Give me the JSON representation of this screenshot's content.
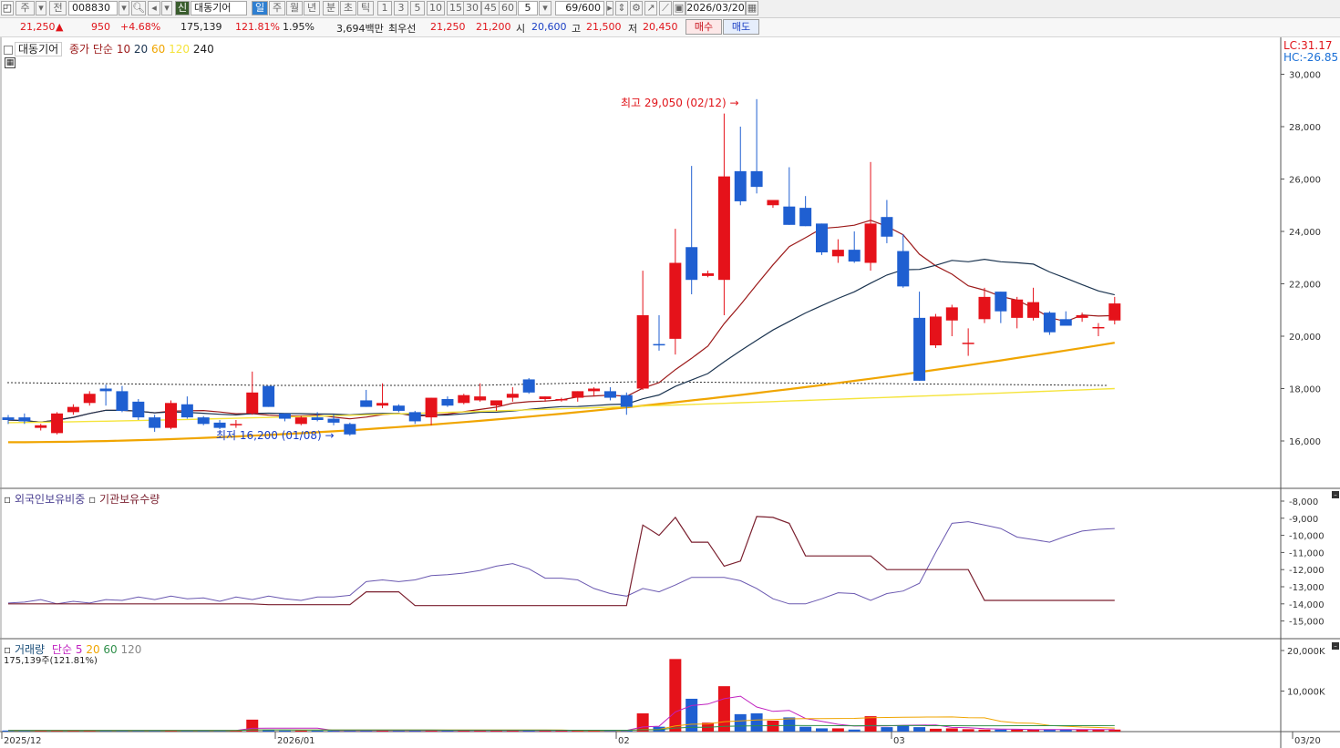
{
  "toolbar": {
    "market": "주",
    "code": "008830",
    "prefix_badge": "신",
    "stock_name": "대동기어",
    "period_tabs": [
      "일",
      "주",
      "월",
      "년",
      "분",
      "초",
      "틱"
    ],
    "minute_steps": [
      "1",
      "3",
      "5",
      "10",
      "15",
      "30",
      "45",
      "60"
    ],
    "interval_value": "5",
    "count_display": "69/600",
    "date": "2026/03/20",
    "left_tag": "전"
  },
  "quote": {
    "price": "21,250",
    "change": "950",
    "change_pct": "+4.68%",
    "volume": "175,139",
    "volume_ratio": "121.81%",
    "turnover_pct": "1.95%",
    "amount": "3,694백만",
    "best_ask_label": "최우선",
    "best_ask": "21,250",
    "best_bid": "21,200",
    "open_label": "시",
    "open": "20,600",
    "high_label": "고",
    "high": "21,500",
    "low_label": "저",
    "low": "20,450",
    "buy_label": "매수",
    "sell_label": "매도"
  },
  "price_panel": {
    "stock_label": "대동기어",
    "ma_title": "종가 단순",
    "ma_periods": [
      "10",
      "20",
      "60",
      "120",
      "240"
    ],
    "lc": "LC:31.17",
    "hc": "HC:-26.85",
    "high_note": "최고 29,050 (02/12)",
    "low_note": "최저 16,200 (01/08)",
    "y_ticks": [
      "30,000",
      "28,000",
      "26,000",
      "24,000",
      "22,000",
      "20,000",
      "18,000",
      "16,000"
    ]
  },
  "holdings_panel": {
    "title_foreign": "외국인보유비중",
    "title_inst": "기관보유수량",
    "y_ticks": [
      "-8,000",
      "-9,000",
      "-10,000",
      "-11,000",
      "-12,000",
      "-13,000",
      "-14,000",
      "-15,000"
    ]
  },
  "volume_panel": {
    "title": "거래량",
    "ma_title": "단순",
    "ma_periods": [
      "5",
      "20",
      "60",
      "120"
    ],
    "current": "175,139주(121.81%)",
    "y_ticks": [
      "20,000K",
      "10,000K"
    ]
  },
  "x_axis": {
    "labels": [
      "2025/12",
      "2026/01",
      "02",
      "03",
      "03/20"
    ]
  },
  "colors": {
    "up": "#e5121a",
    "down": "#1f5fd1",
    "ma10": "#9c1a1a",
    "ma20": "#1b3450",
    "ma60": "#f0a500",
    "ma120": "#f5e43c",
    "foreign": "#6a58b0",
    "inst": "#7a1f2e"
  },
  "chart_data": {
    "type": "candlestick",
    "candles": [
      {
        "o": 16900,
        "h": 16990,
        "l": 16650,
        "c": 16800
      },
      {
        "o": 16900,
        "h": 17050,
        "l": 16650,
        "c": 16750
      },
      {
        "o": 16500,
        "h": 16650,
        "l": 16400,
        "c": 16600
      },
      {
        "o": 16300,
        "h": 17100,
        "l": 16250,
        "c": 17050
      },
      {
        "o": 17100,
        "h": 17400,
        "l": 17000,
        "c": 17300
      },
      {
        "o": 17450,
        "h": 17900,
        "l": 17350,
        "c": 17800
      },
      {
        "o": 18000,
        "h": 18150,
        "l": 17350,
        "c": 17900
      },
      {
        "o": 17900,
        "h": 18100,
        "l": 17100,
        "c": 17150
      },
      {
        "o": 17500,
        "h": 17600,
        "l": 16800,
        "c": 16900
      },
      {
        "o": 16900,
        "h": 17000,
        "l": 16350,
        "c": 16500
      },
      {
        "o": 16500,
        "h": 17550,
        "l": 16450,
        "c": 17450
      },
      {
        "o": 17400,
        "h": 17700,
        "l": 16850,
        "c": 16900
      },
      {
        "o": 16900,
        "h": 16950,
        "l": 16600,
        "c": 16650
      },
      {
        "o": 16700,
        "h": 16800,
        "l": 16450,
        "c": 16500
      },
      {
        "o": 16600,
        "h": 16800,
        "l": 16500,
        "c": 16650
      },
      {
        "o": 17050,
        "h": 18650,
        "l": 17000,
        "c": 17850
      },
      {
        "o": 18100,
        "h": 18100,
        "l": 17400,
        "c": 17300
      },
      {
        "o": 17050,
        "h": 17050,
        "l": 16750,
        "c": 16850
      },
      {
        "o": 16650,
        "h": 16950,
        "l": 16600,
        "c": 16900
      },
      {
        "o": 16900,
        "h": 17100,
        "l": 16750,
        "c": 16800
      },
      {
        "o": 16850,
        "h": 17000,
        "l": 16600,
        "c": 16700
      },
      {
        "o": 16650,
        "h": 16700,
        "l": 16200,
        "c": 16250
      },
      {
        "o": 17550,
        "h": 17950,
        "l": 17300,
        "c": 17300
      },
      {
        "o": 17350,
        "h": 18200,
        "l": 17250,
        "c": 17450
      },
      {
        "o": 17350,
        "h": 17400,
        "l": 17100,
        "c": 17150
      },
      {
        "o": 17100,
        "h": 17150,
        "l": 16650,
        "c": 16750
      },
      {
        "o": 16900,
        "h": 17600,
        "l": 16600,
        "c": 17650
      },
      {
        "o": 17600,
        "h": 17700,
        "l": 17300,
        "c": 17350
      },
      {
        "o": 17450,
        "h": 17800,
        "l": 17400,
        "c": 17750
      },
      {
        "o": 17550,
        "h": 18200,
        "l": 17500,
        "c": 17700
      },
      {
        "o": 17350,
        "h": 17500,
        "l": 17150,
        "c": 17550
      },
      {
        "o": 17650,
        "h": 18050,
        "l": 17500,
        "c": 17800
      },
      {
        "o": 18350,
        "h": 18400,
        "l": 17800,
        "c": 17850
      },
      {
        "o": 17600,
        "h": 17650,
        "l": 17500,
        "c": 17700
      },
      {
        "o": 17600,
        "h": 17650,
        "l": 17500,
        "c": 17600
      },
      {
        "o": 17650,
        "h": 17800,
        "l": 17500,
        "c": 17900
      },
      {
        "o": 17900,
        "h": 18050,
        "l": 17700,
        "c": 18000
      },
      {
        "o": 17900,
        "h": 18050,
        "l": 17550,
        "c": 17650
      },
      {
        "o": 17750,
        "h": 17850,
        "l": 17000,
        "c": 17300
      },
      {
        "o": 18000,
        "h": 22500,
        "l": 17950,
        "c": 20800
      },
      {
        "o": 19700,
        "h": 20800,
        "l": 19450,
        "c": 19650
      },
      {
        "o": 19900,
        "h": 24100,
        "l": 19300,
        "c": 22800
      },
      {
        "o": 23400,
        "h": 26500,
        "l": 21600,
        "c": 22150
      },
      {
        "o": 22300,
        "h": 22500,
        "l": 22250,
        "c": 22400
      },
      {
        "o": 22150,
        "h": 28500,
        "l": 20800,
        "c": 26100
      },
      {
        "o": 26300,
        "h": 28000,
        "l": 25000,
        "c": 25150
      },
      {
        "o": 26300,
        "h": 29050,
        "l": 25450,
        "c": 25700
      },
      {
        "o": 25000,
        "h": 25200,
        "l": 24900,
        "c": 25200
      },
      {
        "o": 24950,
        "h": 26450,
        "l": 24350,
        "c": 24250
      },
      {
        "o": 24900,
        "h": 25350,
        "l": 24450,
        "c": 24200
      },
      {
        "o": 24300,
        "h": 24200,
        "l": 23100,
        "c": 23200
      },
      {
        "o": 23050,
        "h": 23700,
        "l": 22800,
        "c": 23300
      },
      {
        "o": 23300,
        "h": 24000,
        "l": 22800,
        "c": 22850
      },
      {
        "o": 22800,
        "h": 26650,
        "l": 22500,
        "c": 24300
      },
      {
        "o": 24550,
        "h": 25200,
        "l": 23550,
        "c": 23800
      },
      {
        "o": 23250,
        "h": 23900,
        "l": 21850,
        "c": 21900
      },
      {
        "o": 20700,
        "h": 21700,
        "l": 18300,
        "c": 18300
      },
      {
        "o": 19650,
        "h": 20850,
        "l": 19550,
        "c": 20750
      },
      {
        "o": 20600,
        "h": 21200,
        "l": 20000,
        "c": 21100
      },
      {
        "o": 19750,
        "h": 20300,
        "l": 19250,
        "c": 19750
      },
      {
        "o": 20650,
        "h": 21850,
        "l": 20500,
        "c": 21500
      },
      {
        "o": 21700,
        "h": 21700,
        "l": 20500,
        "c": 20950
      },
      {
        "o": 20700,
        "h": 21500,
        "l": 20300,
        "c": 21400
      },
      {
        "o": 20700,
        "h": 21850,
        "l": 20600,
        "c": 21300
      },
      {
        "o": 20900,
        "h": 20950,
        "l": 20050,
        "c": 20150
      },
      {
        "o": 20650,
        "h": 20950,
        "l": 20400,
        "c": 20400
      },
      {
        "o": 20700,
        "h": 20900,
        "l": 20550,
        "c": 20800
      },
      {
        "o": 20350,
        "h": 20500,
        "l": 20000,
        "c": 20350
      },
      {
        "o": 20600,
        "h": 21500,
        "l": 20450,
        "c": 21250
      }
    ],
    "volume_k": [
      260,
      260,
      260,
      260,
      260,
      260,
      260,
      260,
      260,
      260,
      260,
      260,
      260,
      260,
      260,
      2950,
      400,
      260,
      260,
      260,
      260,
      260,
      260,
      450,
      260,
      260,
      260,
      260,
      260,
      260,
      260,
      260,
      260,
      260,
      260,
      260,
      260,
      260,
      400,
      4500,
      1200,
      17900,
      8100,
      2200,
      11200,
      4300,
      4500,
      2700,
      3500,
      1200,
      800,
      800,
      500,
      3800,
      1100,
      1500,
      1100,
      700,
      800,
      600,
      500,
      500,
      500,
      500,
      500,
      500,
      500,
      500,
      500
    ],
    "y_range": [
      15000,
      31000
    ],
    "volume_range_k": [
      0,
      21000
    ]
  }
}
